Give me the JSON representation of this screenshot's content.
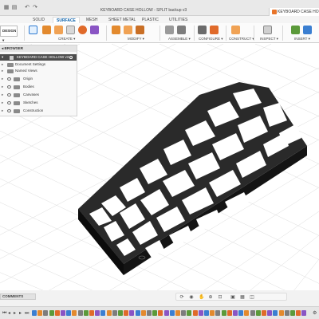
{
  "titlebar": {
    "title": "KEYBOARD CASE HOLLOW - SPLIT backup v3",
    "tab_label": "KEYBOARD CASE HO"
  },
  "tabs": [
    "SOLID",
    "SURFACE",
    "MESH",
    "SHEET METAL",
    "PLASTIC",
    "UTILITIES"
  ],
  "active_tab": "SURFACE",
  "ribbon": {
    "workspace": "DESIGN",
    "groups": [
      "CREATE",
      "MODIFY",
      "ASSEMBLE",
      "CONFIGURE",
      "CONSTRUCT",
      "INSPECT",
      "INSERT"
    ]
  },
  "browser": {
    "header": "BROWSER",
    "root": "KEYBOARD CASE HOLLOW v3",
    "items": [
      "Document Settings",
      "Named Views",
      "Origin",
      "Bodies",
      "Canvases",
      "Sketches",
      "Construction"
    ]
  },
  "bottom": {
    "comments": "COMMENTS"
  },
  "colors": {
    "accent": "#0a5fa8",
    "model": "#1c1c1c",
    "grid": "#dcdcdc"
  }
}
